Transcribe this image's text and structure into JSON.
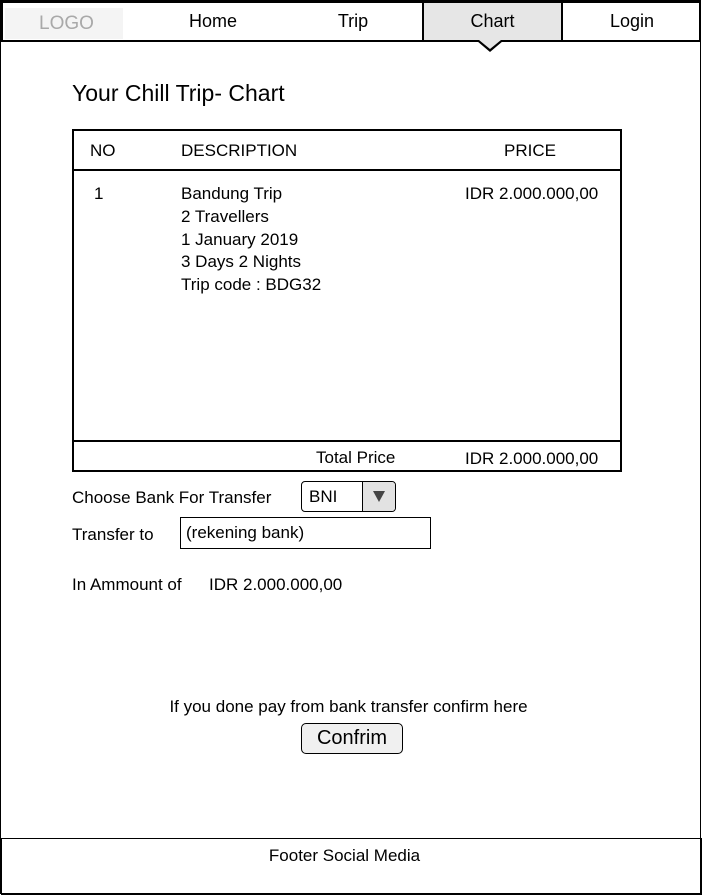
{
  "nav": {
    "logo": "LOGO",
    "items": [
      {
        "label": "Home",
        "active": false
      },
      {
        "label": "Trip",
        "active": false
      },
      {
        "label": "Chart",
        "active": true
      },
      {
        "label": "Login",
        "active": false
      }
    ]
  },
  "page": {
    "title": "Your Chill Trip- Chart"
  },
  "table": {
    "headers": {
      "no": "NO",
      "description": "DESCRIPTION",
      "price": "PRICE"
    },
    "rows": [
      {
        "no": "1",
        "description": [
          "Bandung Trip",
          "2 Travellers",
          "1 January 2019",
          "3 Days 2 Nights",
          "Trip code : BDG32"
        ],
        "price": "IDR 2.000.000,00"
      }
    ],
    "total_label": "Total Price",
    "total_value": "IDR 2.000.000,00"
  },
  "payment": {
    "bank_label": "Choose Bank For Transfer",
    "bank_selected": "BNI",
    "transfer_label": "Transfer to",
    "transfer_placeholder": "(rekening bank)",
    "amount_label": "In Ammount of",
    "amount_value": "IDR 2.000.000,00"
  },
  "confirm": {
    "hint": "If you done pay from bank transfer confirm here",
    "button_label": "Confrim"
  },
  "footer": {
    "text": "Footer Social Media"
  },
  "colors": {
    "active_tab": "#e6e6e6",
    "logo_bg": "#f4f4f4",
    "logo_text": "#a9a9a9",
    "button_bg": "#f0f0f0"
  }
}
